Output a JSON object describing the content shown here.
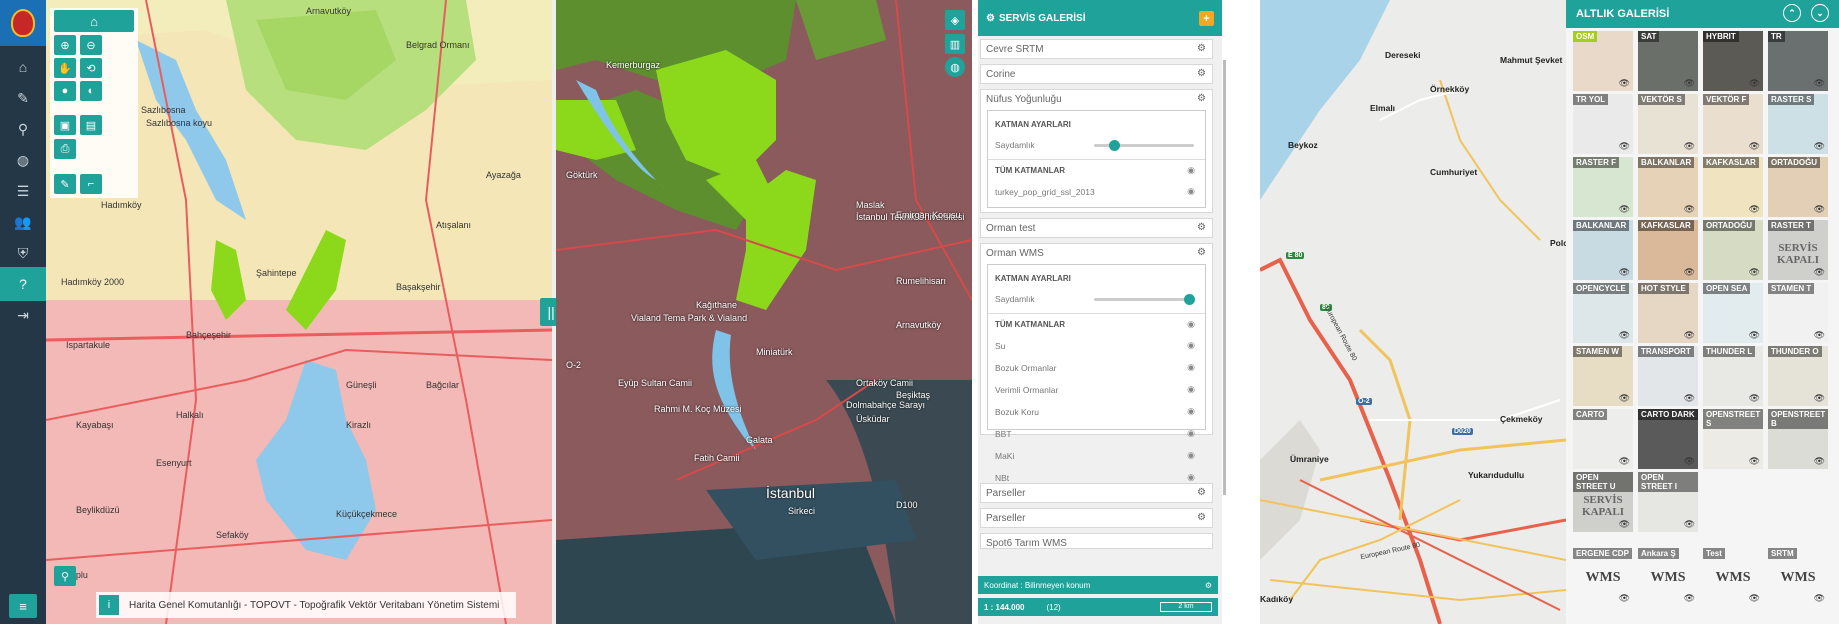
{
  "nav": {
    "items": [
      {
        "name": "home",
        "glyph": "⌂",
        "active": false
      },
      {
        "name": "edit",
        "glyph": "✎",
        "active": false
      },
      {
        "name": "location",
        "glyph": "⚲",
        "active": false
      },
      {
        "name": "globe",
        "glyph": "◍",
        "active": false
      },
      {
        "name": "database",
        "glyph": "☰",
        "active": false
      },
      {
        "name": "users",
        "glyph": "👥",
        "active": false
      },
      {
        "name": "shield",
        "glyph": "⛨",
        "active": false
      },
      {
        "name": "help",
        "glyph": "?",
        "active": true
      },
      {
        "name": "logout",
        "glyph": "⇥",
        "active": false
      }
    ],
    "menu_glyph": "≡"
  },
  "map_left": {
    "labels": [
      "Arnavutköy",
      "Belgrad Ormanı",
      "Sazlıbosna",
      "Sazlıbosna koyu",
      "Hadımköy",
      "Şahintepe",
      "Başakşehir",
      "Bahçeşehir",
      "Ispartakule",
      "Kayabaşı",
      "Esenyurt",
      "Beylikdüzü",
      "Küçükçekmece",
      "Halkalı",
      "Kirazlı",
      "Bağcılar",
      "Sefaköy",
      "Yakuplu",
      "Güneşli",
      "Atışalanı",
      "Ayazağa",
      "Hadımköy 2000"
    ],
    "attribution": "Harita Genel Komutanlığı - TOPOVT - Topoğrafik Vektör Veritabanı Yönetim Sistemi",
    "info_glyph": "i"
  },
  "map_right": {
    "labels": [
      "İstanbul",
      "Eyüp Sultan Camii",
      "Fatih Camii",
      "Miniatürk",
      "Rahmi M. Koç Müzesi",
      "Galata",
      "Dolmabahçe Sarayı",
      "Üsküdar",
      "Ortaköy Camii",
      "Vialand Tema Park & Vialand",
      "Maslak",
      "İstanbul Teknik Üniversitesi",
      "Emirgan Korusu",
      "Rumelihisarı",
      "Arnavutköy",
      "Sirkeci",
      "Kemerburgaz",
      "Göktürk",
      "Kağıthane",
      "Beşiktaş",
      "O-2",
      "D100"
    ]
  },
  "service_gallery": {
    "title": "SERVİS GALERİSİ",
    "add_glyph": "+",
    "collapsed_top": [
      "Cevre SRTM",
      "Corine"
    ],
    "nufus": {
      "title": "Nüfus Yoğunluğu",
      "settings_title": "KATMAN AYARLARI",
      "opacity_label": "Saydamlık",
      "opacity": 0.2,
      "all_layers_title": "TÜM KATMANLAR",
      "layers": [
        "turkey_pop_grid_ssl_2013"
      ]
    },
    "orman_test": "Orman test",
    "orman_wms": {
      "title": "Orman WMS",
      "settings_title": "KATMAN AYARLARI",
      "opacity_label": "Saydamlık",
      "opacity": 1.0,
      "all_layers_title": "TÜM KATMANLAR",
      "layers": [
        "Su",
        "Bozuk Ormanlar",
        "Verimli Ormanlar",
        "Bozuk Koru",
        "BBT",
        "MaKi",
        "NBt"
      ]
    },
    "collapsed_bottom": [
      "Parseller",
      "Parseller",
      "Spot6 Tarım WMS"
    ],
    "coordinate": "Koordinat : Bilinmeyen konum",
    "scale": "1 : 144.000",
    "zoom": "(12)",
    "scale_bar": "2 km"
  },
  "street_map": {
    "labels": [
      "Beykoz",
      "Çekmeköy",
      "Ümraniye",
      "Kadıköy",
      "Elmalı",
      "Örnekköy",
      "Dereseki",
      "Mahmut Şevket",
      "Cumhuriyet",
      "Yukarıdudullu",
      "Polonezköy"
    ],
    "shields": [
      {
        "text": "E 80",
        "color": "#2a8a3e"
      },
      {
        "text": "80",
        "color": "#2a8a3e"
      },
      {
        "text": "O-2",
        "color": "#3a6ea5"
      },
      {
        "text": "D020",
        "color": "#3a6ea5"
      }
    ],
    "road_labels": [
      "European Route 80",
      "European Route 80"
    ]
  },
  "base_gallery": {
    "title": "ALTLIK GALERİSİ",
    "up_glyph": "⌃",
    "down_glyph": "⌄",
    "tiles": [
      {
        "label": "OSM",
        "selected": true,
        "color": "#e8d9c8"
      },
      {
        "label": "SAT",
        "selected": false,
        "color": "#6b6f6a"
      },
      {
        "label": "HYBRIT",
        "selected": false,
        "color": "#5b5a55"
      },
      {
        "label": "TR",
        "selected": false,
        "color": "#6a7070"
      },
      {
        "label": "TR YOL",
        "selected": false,
        "color": "#eaeaea"
      },
      {
        "label": "VEKTÖR S",
        "selected": false,
        "color": "#e8e2d5"
      },
      {
        "label": "VEKTÖR F",
        "selected": false,
        "color": "#eadfcf"
      },
      {
        "label": "RASTER S",
        "selected": false,
        "color": "#cde0e6"
      },
      {
        "label": "RASTER F",
        "selected": false,
        "color": "#d7e6d0"
      },
      {
        "label": "BALKANLAR",
        "selected": false,
        "color": "#e6d2b6"
      },
      {
        "label": "KAFKASLAR",
        "selected": false,
        "color": "#efe3c0"
      },
      {
        "label": "ORTADOĞU",
        "selected": false,
        "color": "#e2cfb6"
      },
      {
        "label": "BALKANLAR",
        "selected": false,
        "color": "#c8dbe3"
      },
      {
        "label": "KAFKASLAR",
        "selected": false,
        "color": "#d9b99a"
      },
      {
        "label": "ORTADOĞU",
        "selected": false,
        "color": "#d6dcc4"
      },
      {
        "label": "RASTER T",
        "selected": false,
        "color": "#cfd0cc",
        "watermark": "SERVİS KAPALI"
      },
      {
        "label": "OPENCYCLE",
        "selected": false,
        "color": "#dde7ea"
      },
      {
        "label": "HOT STYLE",
        "selected": false,
        "color": "#e6d7c5"
      },
      {
        "label": "OPEN SEA",
        "selected": false,
        "color": "#e2ecef"
      },
      {
        "label": "STAMEN T",
        "selected": false,
        "color": "#f1f1f1"
      },
      {
        "label": "STAMEN W",
        "selected": false,
        "color": "#e6ddc4"
      },
      {
        "label": "TRANSPORT",
        "selected": false,
        "color": "#e3e6e8"
      },
      {
        "label": "THUNDER L",
        "selected": false,
        "color": "#e8e8e4"
      },
      {
        "label": "THUNDER O",
        "selected": false,
        "color": "#e5e2d8"
      },
      {
        "label": "CARTO",
        "selected": false,
        "color": "#ededeb"
      },
      {
        "label": "CARTO DARK",
        "selected": false,
        "color": "#5a5a5a"
      },
      {
        "label": "OPENSTREET S",
        "selected": false,
        "color": "#ecebe5"
      },
      {
        "label": "OPENSTREET B",
        "selected": false,
        "color": "#dcdcd6"
      },
      {
        "label": "OPEN STREET U",
        "selected": false,
        "color": "#cfcfcb",
        "watermark": "SERVİS KAPALI"
      },
      {
        "label": "OPEN STREET I",
        "selected": false,
        "color": "#e6e6e2"
      }
    ],
    "wms_tiles": [
      {
        "label": "ERGENE CDP",
        "text": "WMS"
      },
      {
        "label": "Ankara Ş",
        "text": "WMS"
      },
      {
        "label": "Test",
        "text": "WMS"
      },
      {
        "label": "SRTM",
        "text": "WMS"
      }
    ],
    "eye_glyph": "👁"
  },
  "colors": {
    "accent": "#1ea29a",
    "nav_bg": "#243746",
    "forest": "#8cd91c",
    "water": "#8ec8ea"
  }
}
